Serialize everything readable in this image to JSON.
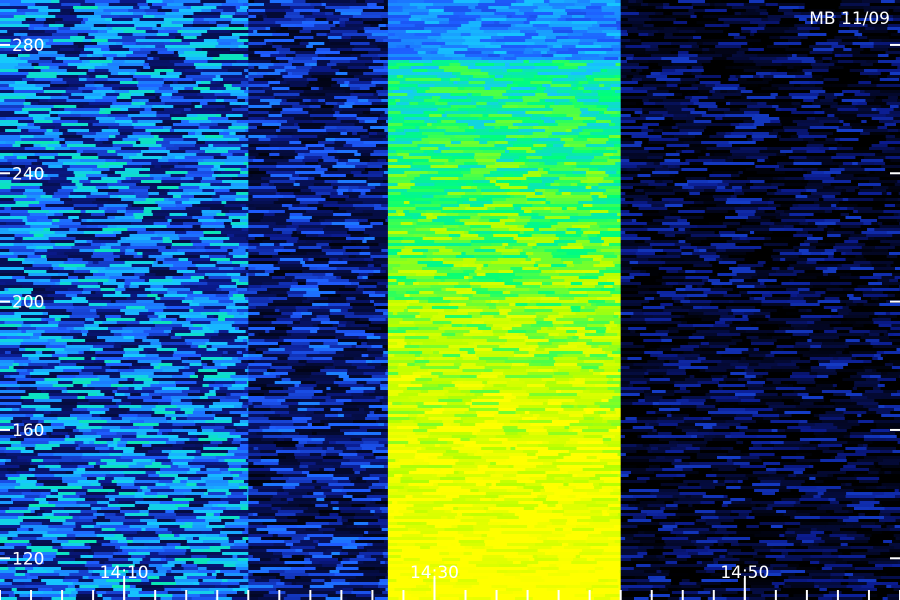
{
  "chart_data": {
    "type": "heatmap",
    "title": "MB 11/09",
    "xlabel": "",
    "ylabel": "",
    "x_ticks": [
      "14:10",
      "14:30",
      "14:50"
    ],
    "y_ticks": [
      280,
      240,
      200,
      160,
      120
    ],
    "xlim": [
      "14:02",
      "15:00"
    ],
    "ylim": [
      107,
      294
    ],
    "colormap": [
      "#000000",
      "#0a1a8c",
      "#1e5cff",
      "#16c8ff",
      "#00ff7a",
      "#b8ff00",
      "#ffff00"
    ],
    "intensity_bands": [
      {
        "from": "14:02",
        "to": "14:18",
        "level": 0.42
      },
      {
        "from": "14:18",
        "to": "14:27",
        "level": 0.22
      },
      {
        "from": "14:27",
        "to": "14:42",
        "level": 0.9
      },
      {
        "from": "14:42",
        "to": "15:00",
        "level": 0.08
      }
    ]
  }
}
